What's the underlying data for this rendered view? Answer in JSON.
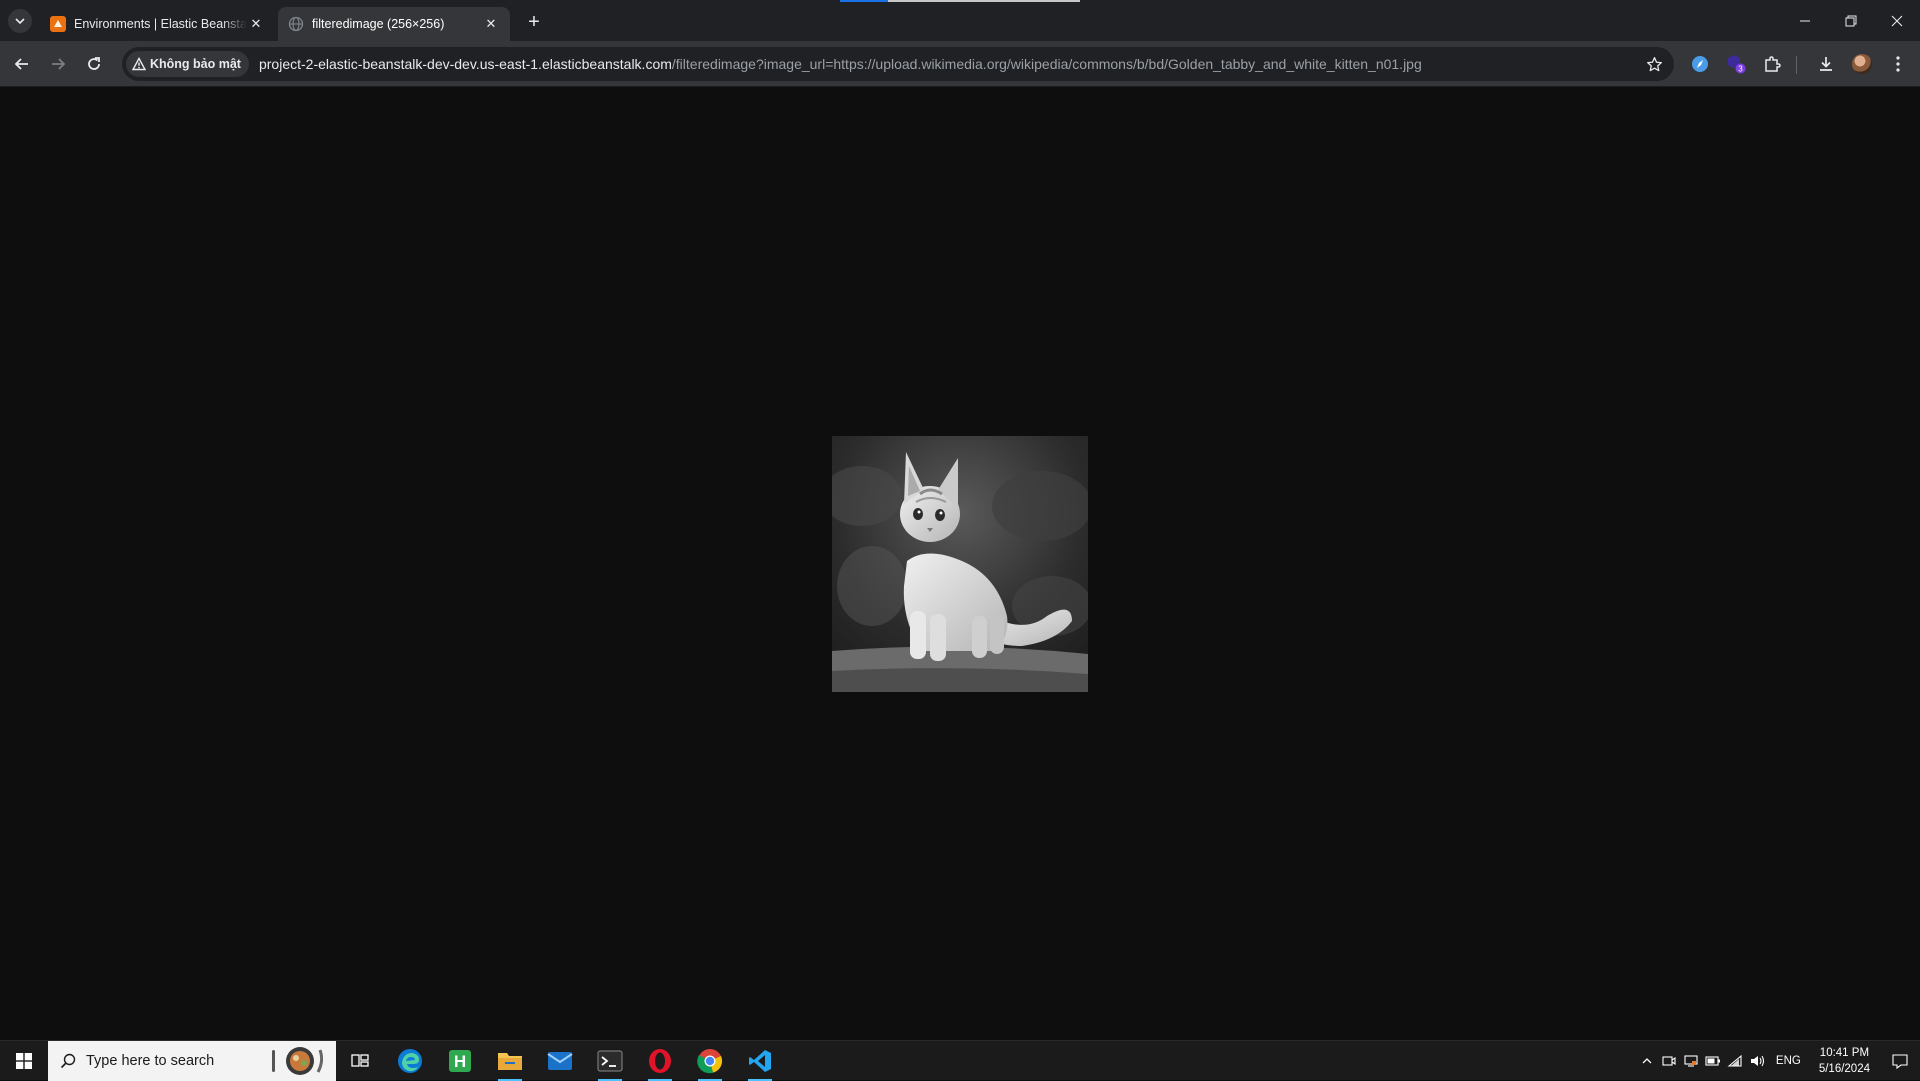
{
  "browser": {
    "tabs": [
      {
        "title": "Environments | Elastic Beanstalk",
        "active": false,
        "favicon": "aws-beanstalk-icon"
      },
      {
        "title": "filteredimage (256×256)",
        "active": true,
        "favicon": "globe-icon"
      }
    ],
    "security_label": "Không bảo mật",
    "url_host": "project-2-elastic-beanstalk-dev-dev.us-east-1.elasticbeanstalk.com",
    "url_path": "/filteredimage?image_url=https://upload.wikimedia.org/wikipedia/commons/b/bd/Golden_tabby_and_white_kitten_n01.jpg",
    "extension_badge": "3"
  },
  "content": {
    "image_alt": "Grayscale kitten",
    "image_icon": "kitten-photo"
  },
  "taskbar": {
    "search_placeholder": "Type here to search",
    "language": "ENG",
    "time": "10:41 PM",
    "date": "5/16/2024",
    "apps": [
      "task-view-icon",
      "edge-icon",
      "h-app-icon",
      "file-explorer-icon",
      "mail-icon",
      "terminal-icon",
      "opera-icon",
      "chrome-icon",
      "vscode-icon"
    ]
  },
  "colors": {
    "tab_bar": "#202124",
    "toolbar": "#35363a",
    "page_bg": "#0e0e0e",
    "accent": "#4cc2ff"
  }
}
